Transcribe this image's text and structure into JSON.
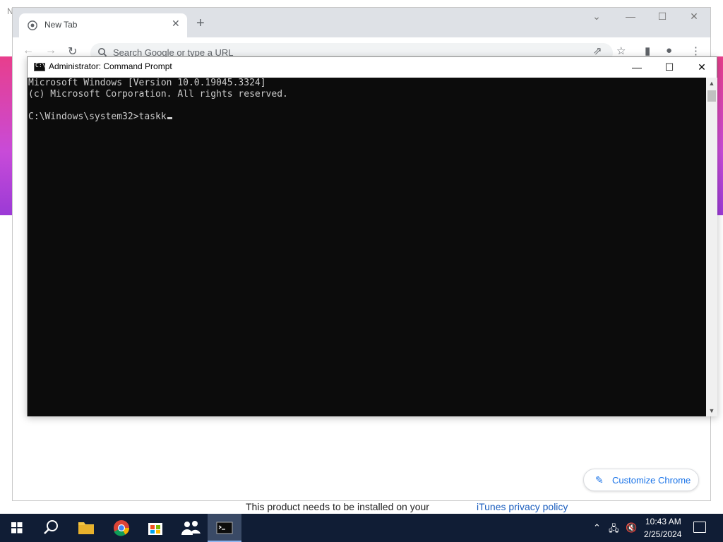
{
  "background": {
    "partial_letter": "N",
    "install_text": "This product needs to be installed on your",
    "itunes_link": "iTunes privacy policy"
  },
  "chrome": {
    "tab_title": "New Tab",
    "tab_close": "✕",
    "new_tab": "+",
    "omnibox_placeholder": "Search Google or type a URL",
    "customize_label": "Customize Chrome",
    "customize_icon": "pencil-icon",
    "win_min": "—",
    "win_max": "☐",
    "win_close": "✕",
    "tab_dropdown": "⌄"
  },
  "cmd": {
    "title": "Administrator: Command Prompt",
    "lines": [
      "Microsoft Windows [Version 10.0.19045.3324]",
      "(c) Microsoft Corporation. All rights reserved.",
      "",
      "C:\\Windows\\system32>taskk"
    ],
    "win_min": "—",
    "win_max": "☐",
    "win_close": "✕"
  },
  "taskbar": {
    "apps": [
      {
        "name": "start",
        "icon": "windows-icon"
      },
      {
        "name": "search",
        "icon": "search-icon"
      },
      {
        "name": "file-explorer",
        "icon": "folder-icon"
      },
      {
        "name": "chrome",
        "icon": "chrome-icon"
      },
      {
        "name": "store",
        "icon": "store-icon"
      },
      {
        "name": "people",
        "icon": "people-icon"
      },
      {
        "name": "cmd",
        "icon": "cmd-icon",
        "active": true
      }
    ],
    "time": "10:43 AM",
    "date": "2/25/2024"
  },
  "colors": {
    "taskbar": "#101d35",
    "cmd_bg": "#0c0c0c",
    "cmd_fg": "#cccccc",
    "chrome_accent": "#1a73e8"
  }
}
